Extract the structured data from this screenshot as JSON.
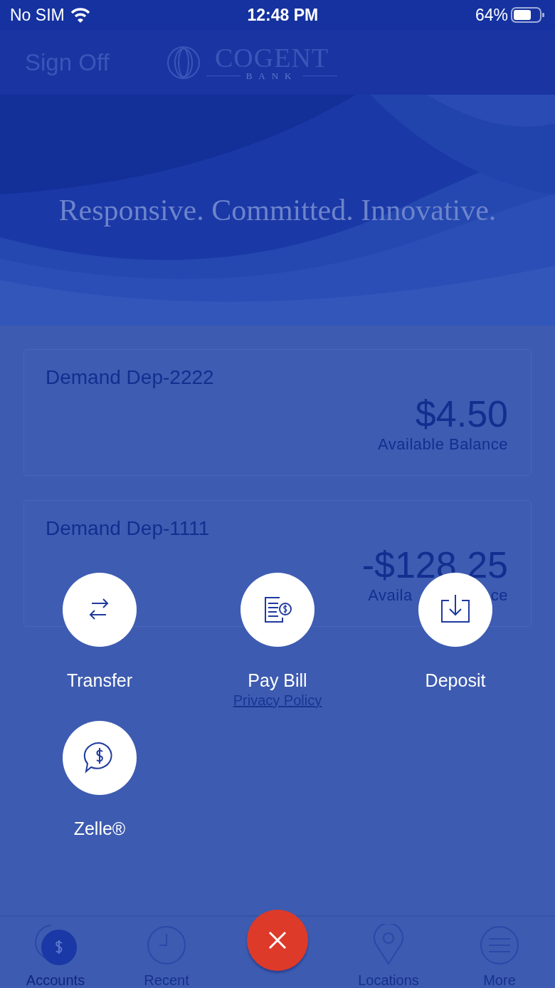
{
  "status_bar": {
    "carrier": "No SIM",
    "time": "12:48 PM",
    "battery": "64%"
  },
  "nav_bar": {
    "sign_off": "Sign Off",
    "logo_name": "COGENT",
    "logo_sub": "BANK"
  },
  "banner": {
    "kind": "picture",
    "slogan": "Responsive. Committed. Innovative."
  },
  "accounts": [
    {
      "name": "Demand Dep-2222",
      "amount": "$4.50",
      "caption": "Available Balance"
    },
    {
      "name": "Demand Dep-1111",
      "amount": "-$128.25",
      "caption_parts": [
        "Availa",
        "ce"
      ]
    }
  ],
  "privacy_link": "Privacy Policy",
  "actions": [
    {
      "kind": "transfer",
      "label": "Transfer"
    },
    {
      "kind": "pay-bill",
      "label": "Pay Bill"
    },
    {
      "kind": "deposit",
      "label": "Deposit"
    },
    {
      "kind": "zelle",
      "label": "Zelle®"
    }
  ],
  "tab_bar": [
    {
      "kind": "accounts",
      "label": "Accounts",
      "selected": true
    },
    {
      "kind": "recent",
      "label": "Recent",
      "selected": false
    },
    {
      "kind": "close"
    },
    {
      "kind": "locations",
      "label": "Locations",
      "selected": false
    },
    {
      "kind": "more",
      "label": "More",
      "selected": false
    }
  ]
}
